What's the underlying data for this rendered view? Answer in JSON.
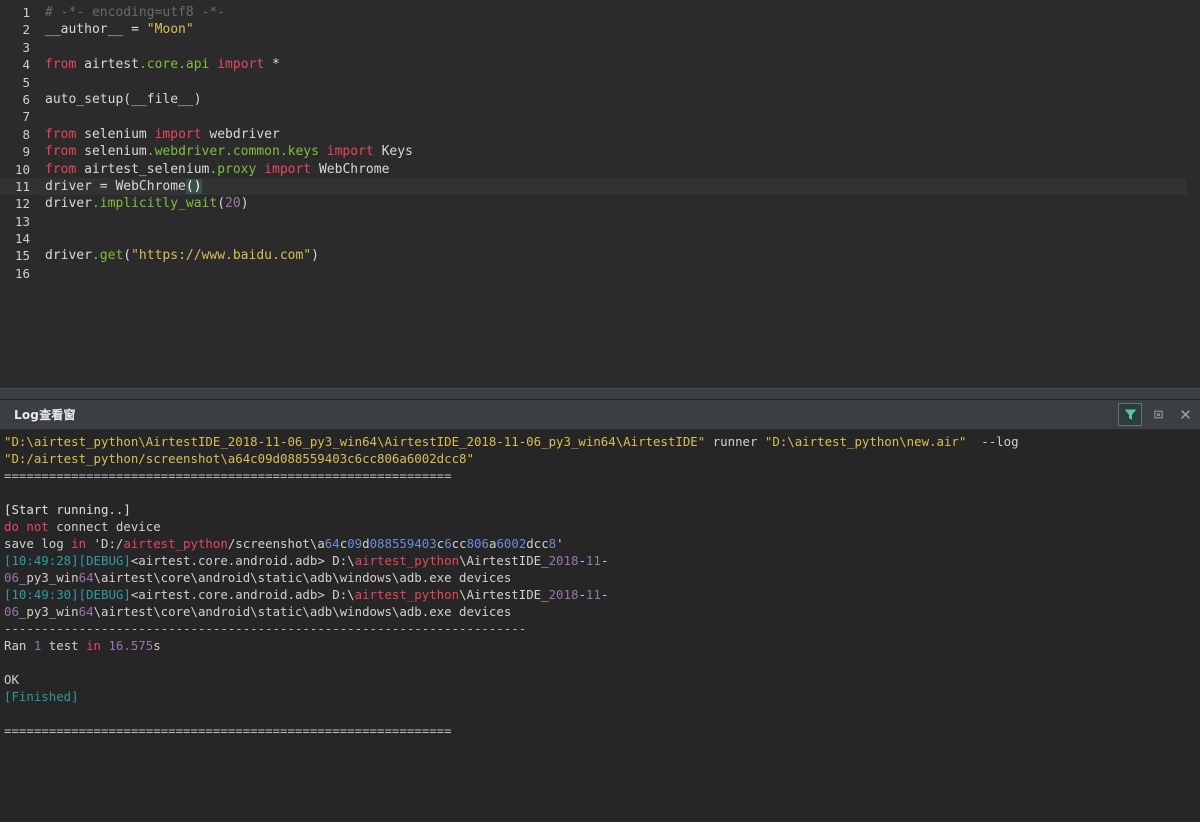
{
  "editor": {
    "name": "python-code-editor",
    "language": "python",
    "current_line": 11,
    "lines": [
      {
        "n": "1",
        "tokens": [
          {
            "t": "# -*- encoding=utf8 -*-",
            "c": "t-cmt"
          }
        ]
      },
      {
        "n": "2",
        "tokens": [
          {
            "t": "__author__ ",
            "c": "t-id"
          },
          {
            "t": "= ",
            "c": "t-id"
          },
          {
            "t": "\"Moon\"",
            "c": "t-str"
          }
        ]
      },
      {
        "n": "3",
        "tokens": []
      },
      {
        "n": "4",
        "tokens": [
          {
            "t": "from ",
            "c": "t-imp"
          },
          {
            "t": "airtest",
            "c": "t-id"
          },
          {
            "t": ".core.api ",
            "c": "t-fn"
          },
          {
            "t": "import ",
            "c": "t-imp"
          },
          {
            "t": "*",
            "c": "t-id"
          }
        ]
      },
      {
        "n": "5",
        "tokens": []
      },
      {
        "n": "6",
        "tokens": [
          {
            "t": "auto_setup(__file__)",
            "c": "t-id"
          }
        ]
      },
      {
        "n": "7",
        "tokens": []
      },
      {
        "n": "8",
        "tokens": [
          {
            "t": "from ",
            "c": "t-imp"
          },
          {
            "t": "selenium ",
            "c": "t-id"
          },
          {
            "t": "import ",
            "c": "t-imp"
          },
          {
            "t": "webdriver",
            "c": "t-id"
          }
        ]
      },
      {
        "n": "9",
        "tokens": [
          {
            "t": "from ",
            "c": "t-imp"
          },
          {
            "t": "selenium",
            "c": "t-id"
          },
          {
            "t": ".webdriver.common.keys ",
            "c": "t-fn"
          },
          {
            "t": "import ",
            "c": "t-imp"
          },
          {
            "t": "Keys",
            "c": "t-id"
          }
        ]
      },
      {
        "n": "10",
        "tokens": [
          {
            "t": "from ",
            "c": "t-imp"
          },
          {
            "t": "airtest_selenium",
            "c": "t-id"
          },
          {
            "t": ".proxy ",
            "c": "t-fn"
          },
          {
            "t": "import ",
            "c": "t-imp"
          },
          {
            "t": "WebChrome",
            "c": "t-id"
          }
        ]
      },
      {
        "n": "11",
        "tokens": [
          {
            "t": "driver = WebChrome",
            "c": "t-id"
          },
          {
            "t": "()",
            "c": "t-bracket"
          }
        ]
      },
      {
        "n": "12",
        "tokens": [
          {
            "t": "driver",
            "c": "t-id"
          },
          {
            "t": ".implicitly_wait",
            "c": "t-fn"
          },
          {
            "t": "(",
            "c": "t-id"
          },
          {
            "t": "20",
            "c": "t-num"
          },
          {
            "t": ")",
            "c": "t-id"
          }
        ]
      },
      {
        "n": "13",
        "tokens": []
      },
      {
        "n": "14",
        "tokens": []
      },
      {
        "n": "15",
        "tokens": [
          {
            "t": "driver",
            "c": "t-id"
          },
          {
            "t": ".get",
            "c": "t-fn"
          },
          {
            "t": "(",
            "c": "t-id"
          },
          {
            "t": "\"https://www.baidu.com\"",
            "c": "t-str"
          },
          {
            "t": ")",
            "c": "t-id"
          }
        ]
      },
      {
        "n": "16",
        "tokens": []
      }
    ]
  },
  "log_panel": {
    "title": "Log查看窗",
    "buttons": [
      {
        "name": "filter-icon",
        "label": "Filter",
        "icon": "funnel",
        "active": true
      },
      {
        "name": "maximize-icon",
        "label": "Maximize",
        "icon": "square",
        "active": false
      },
      {
        "name": "close-icon",
        "label": "Close",
        "icon": "x",
        "active": false
      }
    ],
    "lines": [
      [
        {
          "t": "\"D:\\airtest_python\\AirtestIDE_2018-11-06_py3_win64\\AirtestIDE_2018-11-06_py3_win64\\AirtestIDE\"",
          "c": "l-path"
        },
        {
          "t": " runner ",
          "c": "l-plain"
        },
        {
          "t": "\"D:\\airtest_python\\new.air\"",
          "c": "l-path"
        },
        {
          "t": "  --log",
          "c": "l-plain"
        }
      ],
      [
        {
          "t": "\"D:/airtest_python/screenshot\\a64c09d088559403c6cc806a6002dcc8\"",
          "c": "l-path"
        }
      ],
      [
        {
          "t": "============================================================",
          "c": "l-dim"
        }
      ],
      [],
      [
        {
          "t": "[Start running..]",
          "c": "l-white"
        }
      ],
      [
        {
          "t": "do not",
          "c": "l-red"
        },
        {
          "t": " connect device",
          "c": "l-plain"
        }
      ],
      [
        {
          "t": "save log ",
          "c": "l-plain"
        },
        {
          "t": "in",
          "c": "l-red"
        },
        {
          "t": " 'D:/",
          "c": "l-plain"
        },
        {
          "t": "airtest_python",
          "c": "l-red"
        },
        {
          "t": "/screenshot\\a",
          "c": "l-plain"
        },
        {
          "t": "64",
          "c": "l-num"
        },
        {
          "t": "c",
          "c": "l-plain"
        },
        {
          "t": "09",
          "c": "l-num"
        },
        {
          "t": "d",
          "c": "l-plain"
        },
        {
          "t": "088559403",
          "c": "l-num"
        },
        {
          "t": "c",
          "c": "l-plain"
        },
        {
          "t": "6",
          "c": "l-num"
        },
        {
          "t": "cc",
          "c": "l-plain"
        },
        {
          "t": "806",
          "c": "l-num"
        },
        {
          "t": "a",
          "c": "l-plain"
        },
        {
          "t": "6002",
          "c": "l-num"
        },
        {
          "t": "dcc",
          "c": "l-plain"
        },
        {
          "t": "8",
          "c": "l-num"
        },
        {
          "t": "'",
          "c": "l-plain"
        }
      ],
      [
        {
          "t": "[10:49:28]",
          "c": "l-teal"
        },
        {
          "t": "[DEBUG]",
          "c": "l-teal"
        },
        {
          "t": "<airtest.core.android.adb> D:\\",
          "c": "l-plain"
        },
        {
          "t": "airtest_python",
          "c": "l-red"
        },
        {
          "t": "\\AirtestIDE_",
          "c": "l-plain"
        },
        {
          "t": "2018",
          "c": "l-purple"
        },
        {
          "t": "-",
          "c": "l-plain"
        },
        {
          "t": "11",
          "c": "l-purple"
        },
        {
          "t": "-",
          "c": "l-plain"
        }
      ],
      [
        {
          "t": "06",
          "c": "l-purple"
        },
        {
          "t": "_py3_win",
          "c": "l-plain"
        },
        {
          "t": "64",
          "c": "l-purple"
        },
        {
          "t": "\\airtest\\core\\android\\static\\adb\\windows\\adb.exe devices",
          "c": "l-plain"
        }
      ],
      [
        {
          "t": "[10:49:30]",
          "c": "l-teal"
        },
        {
          "t": "[DEBUG]",
          "c": "l-teal"
        },
        {
          "t": "<airtest.core.android.adb> D:\\",
          "c": "l-plain"
        },
        {
          "t": "airtest_python",
          "c": "l-red"
        },
        {
          "t": "\\AirtestIDE_",
          "c": "l-plain"
        },
        {
          "t": "2018",
          "c": "l-purple"
        },
        {
          "t": "-",
          "c": "l-plain"
        },
        {
          "t": "11",
          "c": "l-purple"
        },
        {
          "t": "-",
          "c": "l-plain"
        }
      ],
      [
        {
          "t": "06",
          "c": "l-purple"
        },
        {
          "t": "_py3_win",
          "c": "l-plain"
        },
        {
          "t": "64",
          "c": "l-purple"
        },
        {
          "t": "\\airtest\\core\\android\\static\\adb\\windows\\adb.exe devices",
          "c": "l-plain"
        }
      ],
      [
        {
          "t": "----------------------------------------------------------------------",
          "c": "l-dim"
        }
      ],
      [
        {
          "t": "Ran ",
          "c": "l-plain"
        },
        {
          "t": "1",
          "c": "l-purple"
        },
        {
          "t": " test ",
          "c": "l-plain"
        },
        {
          "t": "in",
          "c": "l-red"
        },
        {
          "t": " ",
          "c": "l-plain"
        },
        {
          "t": "16.575",
          "c": "l-purple"
        },
        {
          "t": "s",
          "c": "l-plain"
        }
      ],
      [],
      [
        {
          "t": "OK",
          "c": "l-plain"
        }
      ],
      [
        {
          "t": "[Finished]",
          "c": "l-cyan"
        }
      ],
      [],
      [
        {
          "t": "============================================================",
          "c": "l-dim"
        }
      ]
    ]
  },
  "colors": {
    "editor_bg": "#2b2b2b",
    "log_bg": "#262626",
    "header_bg": "#3c3f41",
    "current_line": "#323232",
    "accent_teal": "#4e7d73",
    "keyword": "#e8455f",
    "string": "#d6bf55",
    "function": "#7fbf3f",
    "number": "#9876aa",
    "comment": "#6a6a6a"
  }
}
